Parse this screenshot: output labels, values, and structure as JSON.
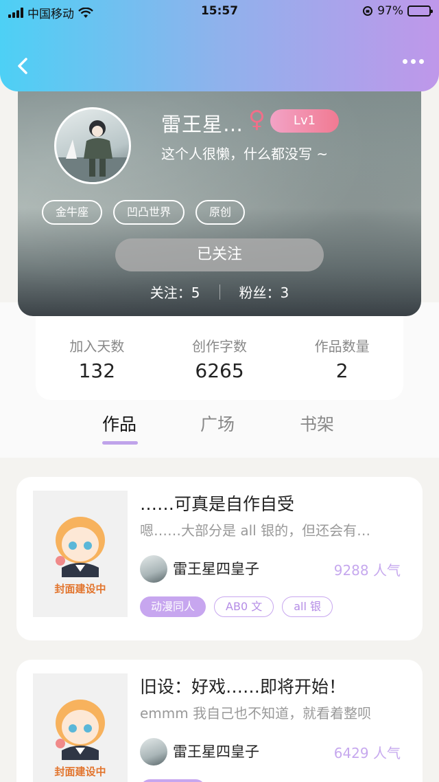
{
  "status_bar": {
    "carrier": "中国移动",
    "time": "15:57",
    "battery": "97%"
  },
  "profile": {
    "nickname": "雷王星…",
    "gender_symbol": "♀",
    "level": "Lv1",
    "bio": "这个人很懒，什么都没写 ~",
    "tags": [
      "金牛座",
      "凹凸世界",
      "原创"
    ],
    "follow_button": "已关注",
    "following": "关注：5",
    "followers": "粉丝：3"
  },
  "stats": [
    {
      "label": "加入天数",
      "value": "132"
    },
    {
      "label": "创作字数",
      "value": "6265"
    },
    {
      "label": "作品数量",
      "value": "2"
    }
  ],
  "tabs": [
    "作品",
    "广场",
    "书架"
  ],
  "works": [
    {
      "cover_text": "封面建设中",
      "title": "……可真是自作自受",
      "summary": "嗯……大部分是 all 银的，但还会有…",
      "author": "雷王星四皇子",
      "popularity": "9288 人气",
      "chips": [
        "动漫同人",
        "AB0 文",
        "all 银"
      ]
    },
    {
      "cover_text": "封面建设中",
      "title": "旧设：好戏……即将开始！",
      "summary": "emmm 我自己也不知道，就看着整呗",
      "author": "雷王星四皇子",
      "popularity": "6429 人气"
    }
  ],
  "colors": {
    "accent": "#c7a6ef",
    "level_badge": "#f17a92",
    "cover_text": "#e2752e"
  }
}
